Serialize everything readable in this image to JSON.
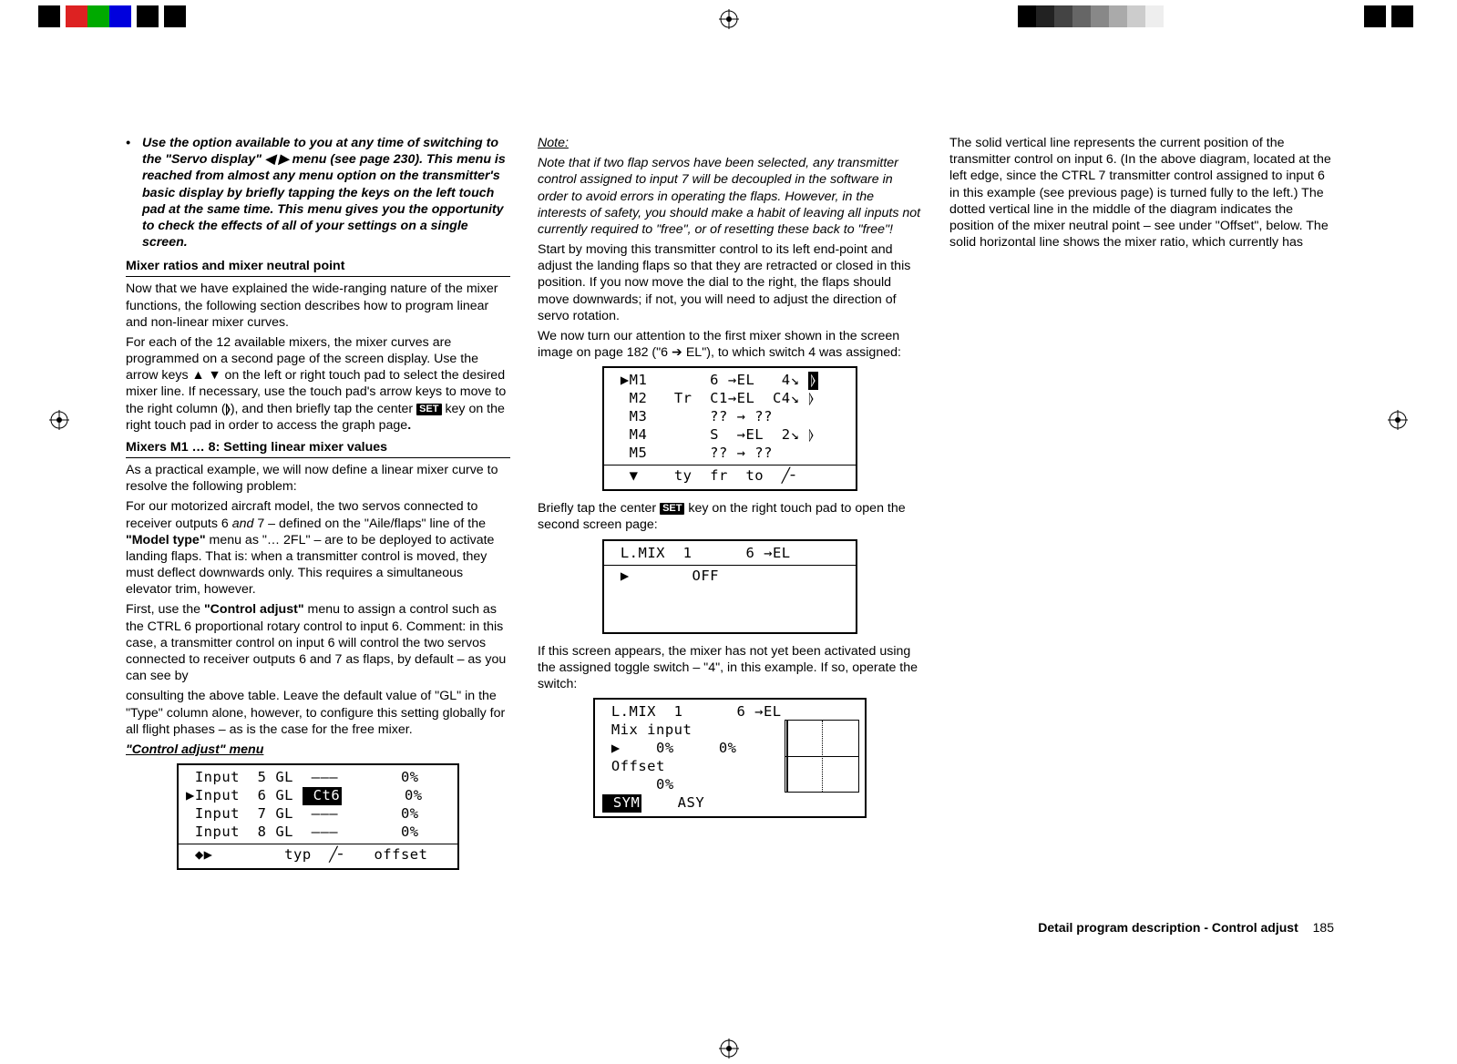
{
  "col1": {
    "bullet": "Use the option available to you at any time of switching to the \"Servo display\" ◀ ▶ menu (see page 230). This menu is reached from almost any menu option on the transmitter's basic display by briefly tapping the keys on the left touch pad at the same time. This menu gives you the opportunity to check the effects of all of your settings on a single screen.",
    "h1": "Mixer ratios and mixer neutral point",
    "p1": "Now that we have explained the wide-ranging nature of the mixer functions, the following section describes how to program linear and non-linear mixer curves.",
    "p2a": "For each of the 12 available mixers, the mixer curves are programmed on a second page of the screen display. Use the arrow keys ▲ ▼ on the left or right touch pad to select the desired mixer line. If necessary, use the touch pad's arrow keys to move to the right column (",
    "p2b": "), and then briefly tap the center ",
    "p2c": " key on the right touch pad in order to access the graph page",
    "h2": "Mixers M1 … 8: Setting linear mixer values",
    "p3": "As a practical example, we will now define a linear mixer curve to resolve the following problem:",
    "p4a": "For our motorized aircraft model, the two servos connected to receiver outputs 6 ",
    "p4and": "and",
    "p4b": " 7 – defined on the \"Aile/flaps\" line of the ",
    "p4bold": "\"Model type\"",
    "p4c": " menu as \"… 2FL\" – are to be deployed to activate landing flaps. That is: when a transmitter control is moved, they must deflect downwards only. This requires a simultaneous elevator trim, however.",
    "p5a": "First, use the ",
    "p5bold": "\"Control adjust\"",
    "p5b": " menu to assign a control such as the CTRL 6 proportional rotary control to input 6. Comment: in this case, a transmitter control on input 6 will control the two servos connected to receiver outputs 6 and 7 as flaps, by default  –  as you can see by"
  },
  "col2": {
    "p1": "consulting the above table.  Leave the default value of \"GL\" in the \"Type\" column alone, however, to configure this setting globally for all flight phases – as is the case for the free mixer.",
    "h1": "\"Control adjust\" menu",
    "screen1": {
      "r1": " Input  5 GL  –––       0%",
      "r2_a": "▶Input  6 GL ",
      "r2_hl": " Ct6",
      "r2_b": "       0%",
      "r3": " Input  7 GL  –––       0%",
      "r4": " Input  8 GL  –––       0%",
      "r5": " ◆▶        typ  ╱╴   offset"
    },
    "noteHead": "Note:",
    "noteBody": "Note that if two flap servos have been selected, any transmitter control assigned to input 7 will be decoupled in the software in order to avoid errors in operating the flaps. However, in the interests of safety, you should make a habit of leaving all inputs not currently required to \"free\", or of resetting these back to \"free\"!",
    "p2": "Start by moving this transmitter control to its left end-point and adjust the landing flaps so that they are retracted or closed in this position. If you now move the dial to the right, the flaps should move downwards; if not, you will need to adjust the direction of servo rotation.",
    "p3": "We now turn our attention to the first mixer shown in the screen image on page 182 (\"6 ➔ EL\"), to which switch 4 was assigned:"
  },
  "col3": {
    "screen1": {
      "r1a": " ▶M1       6 →EL   4↘ ",
      "r1hl": "⦊",
      "r2": "  M2   Tr  C1→EL  C4↘ ⦊",
      "r3": "  M3       ?? → ??",
      "r4": "  M4       S  →EL  2↘ ⦊",
      "r5": "  M5       ?? → ??",
      "r6": "  ▼    ty  fr  to  ╱╴"
    },
    "p1a": "Briefly tap the center ",
    "p1b": " key on the right touch pad to open the second screen page:",
    "screen2": {
      "r1": " L.MIX  1      6 →EL",
      "r2": " ▶       OFF"
    },
    "p2": "If this screen appears, the mixer has not yet been activated using the assigned toggle switch – \"4\", in this example.  If so, operate the switch:",
    "screen3": {
      "r1": " L.MIX  1      6 →EL",
      "r2": " Mix input",
      "r3": " ▶    0%     0%",
      "r4": " Offset",
      "r5": "      0%",
      "r6_hl": " SYM",
      "r6_b": "    ASY"
    },
    "p3": "The solid vertical line represents the current position of the transmitter control on input 6. (In the above diagram, located at the left edge, since the CTRL 7 transmitter control assigned to input 6 in this example (see previous page) is turned fully to the left.) The dotted vertical line in the middle of the diagram indicates the position of the mixer neutral point – see under \"Offset\", below. The solid horizontal line shows the mixer ratio, which currently has"
  },
  "footer": {
    "title": "Detail program description - Control adjust",
    "page": "185"
  },
  "set_label": "SET"
}
